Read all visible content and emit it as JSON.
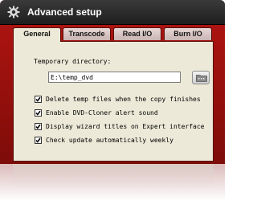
{
  "window": {
    "title": "Advanced setup"
  },
  "tabs": [
    {
      "label": "General",
      "active": true
    },
    {
      "label": "Transcode",
      "active": false
    },
    {
      "label": "Read I/O",
      "active": false
    },
    {
      "label": "Burn I/O",
      "active": false
    }
  ],
  "general": {
    "temp_dir_label": "Temporary directory:",
    "temp_dir_value": "E:\\temp_dvd",
    "options": [
      {
        "label": "Delete temp files when the copy finishes",
        "checked": true
      },
      {
        "label": "Enable DVD-Cloner alert sound",
        "checked": true
      },
      {
        "label": "Display wizard titles on Expert interface",
        "checked": true
      },
      {
        "label": "Check update automatically weekly",
        "checked": true
      }
    ]
  },
  "icons": {
    "title": "gear-icon",
    "browse": "folder-icon",
    "check": "checkmark-icon"
  },
  "colors": {
    "frame": "#b41511",
    "titlebar": "#2b2b2b",
    "panel": "#ece9d8"
  }
}
